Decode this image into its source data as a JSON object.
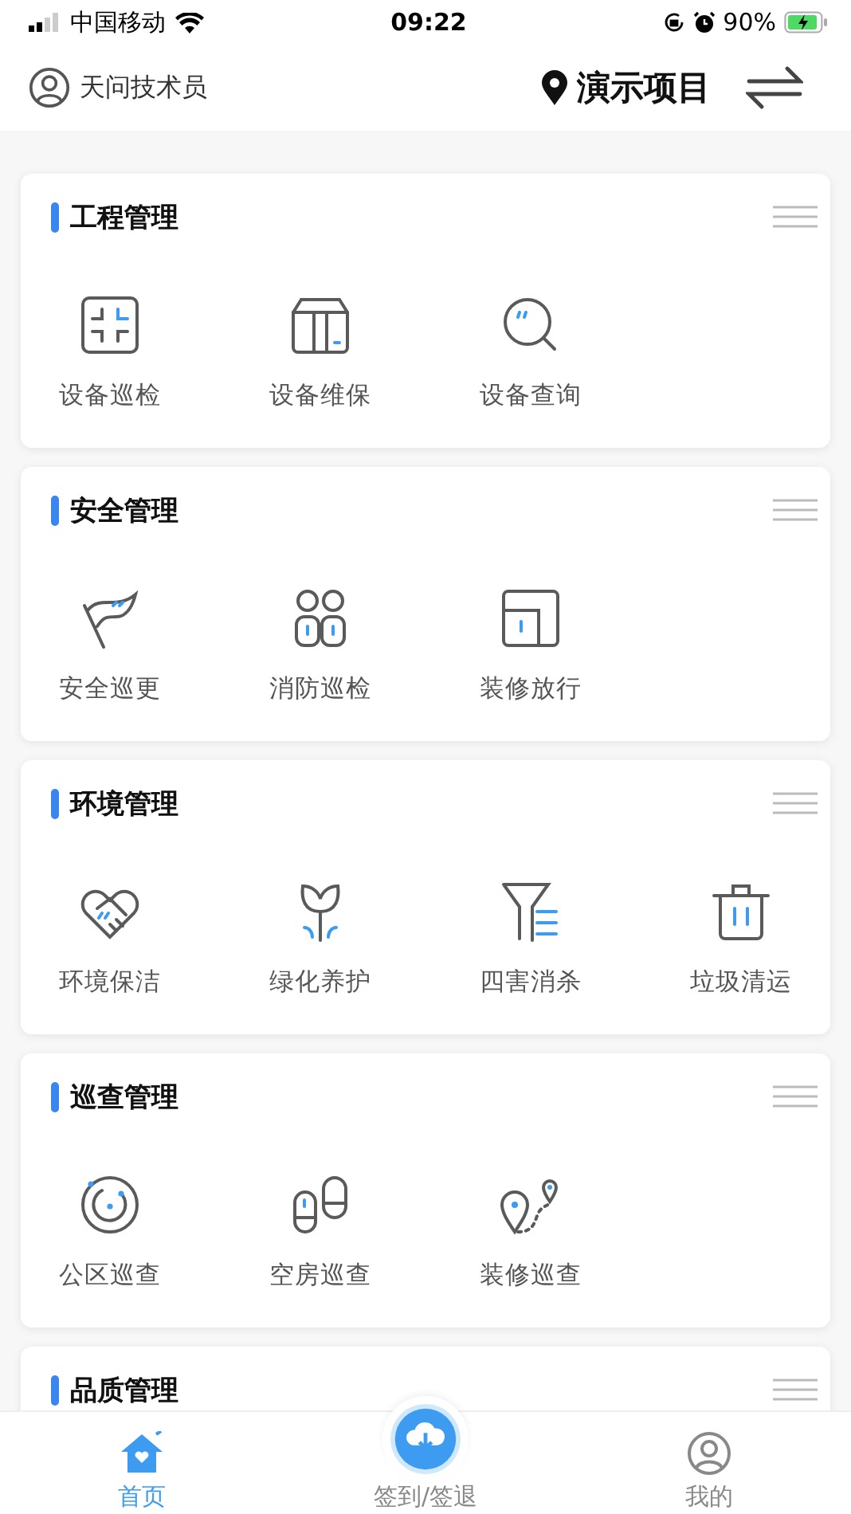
{
  "status_bar": {
    "carrier": "中国移动",
    "time": "09:22",
    "battery": "90%"
  },
  "header": {
    "user": "天问技术员",
    "project": "演示项目"
  },
  "sections": [
    {
      "title": "工程管理",
      "items": [
        {
          "label": "设备巡检",
          "kind": "scan"
        },
        {
          "label": "设备维保",
          "kind": "cabinet"
        },
        {
          "label": "设备查询",
          "kind": "search"
        }
      ]
    },
    {
      "title": "安全管理",
      "items": [
        {
          "label": "安全巡更",
          "kind": "flag"
        },
        {
          "label": "消防巡检",
          "kind": "people"
        },
        {
          "label": "装修放行",
          "kind": "door"
        }
      ]
    },
    {
      "title": "环境管理",
      "items": [
        {
          "label": "环境保洁",
          "kind": "handshake"
        },
        {
          "label": "绿化养护",
          "kind": "sprout"
        },
        {
          "label": "四害消杀",
          "kind": "funnel"
        },
        {
          "label": "垃圾清运",
          "kind": "trash"
        }
      ]
    },
    {
      "title": "巡查管理",
      "items": [
        {
          "label": "公区巡查",
          "kind": "radar"
        },
        {
          "label": "空房巡查",
          "kind": "footprints"
        },
        {
          "label": "装修巡查",
          "kind": "route"
        }
      ]
    },
    {
      "title": "品质管理"
    }
  ],
  "tab_bar": [
    {
      "label": "首页",
      "kind": "home",
      "selected": true
    },
    {
      "label": "签到/签退",
      "kind": "checkin",
      "selected": false
    },
    {
      "label": "我的",
      "kind": "profile",
      "selected": false
    }
  ]
}
